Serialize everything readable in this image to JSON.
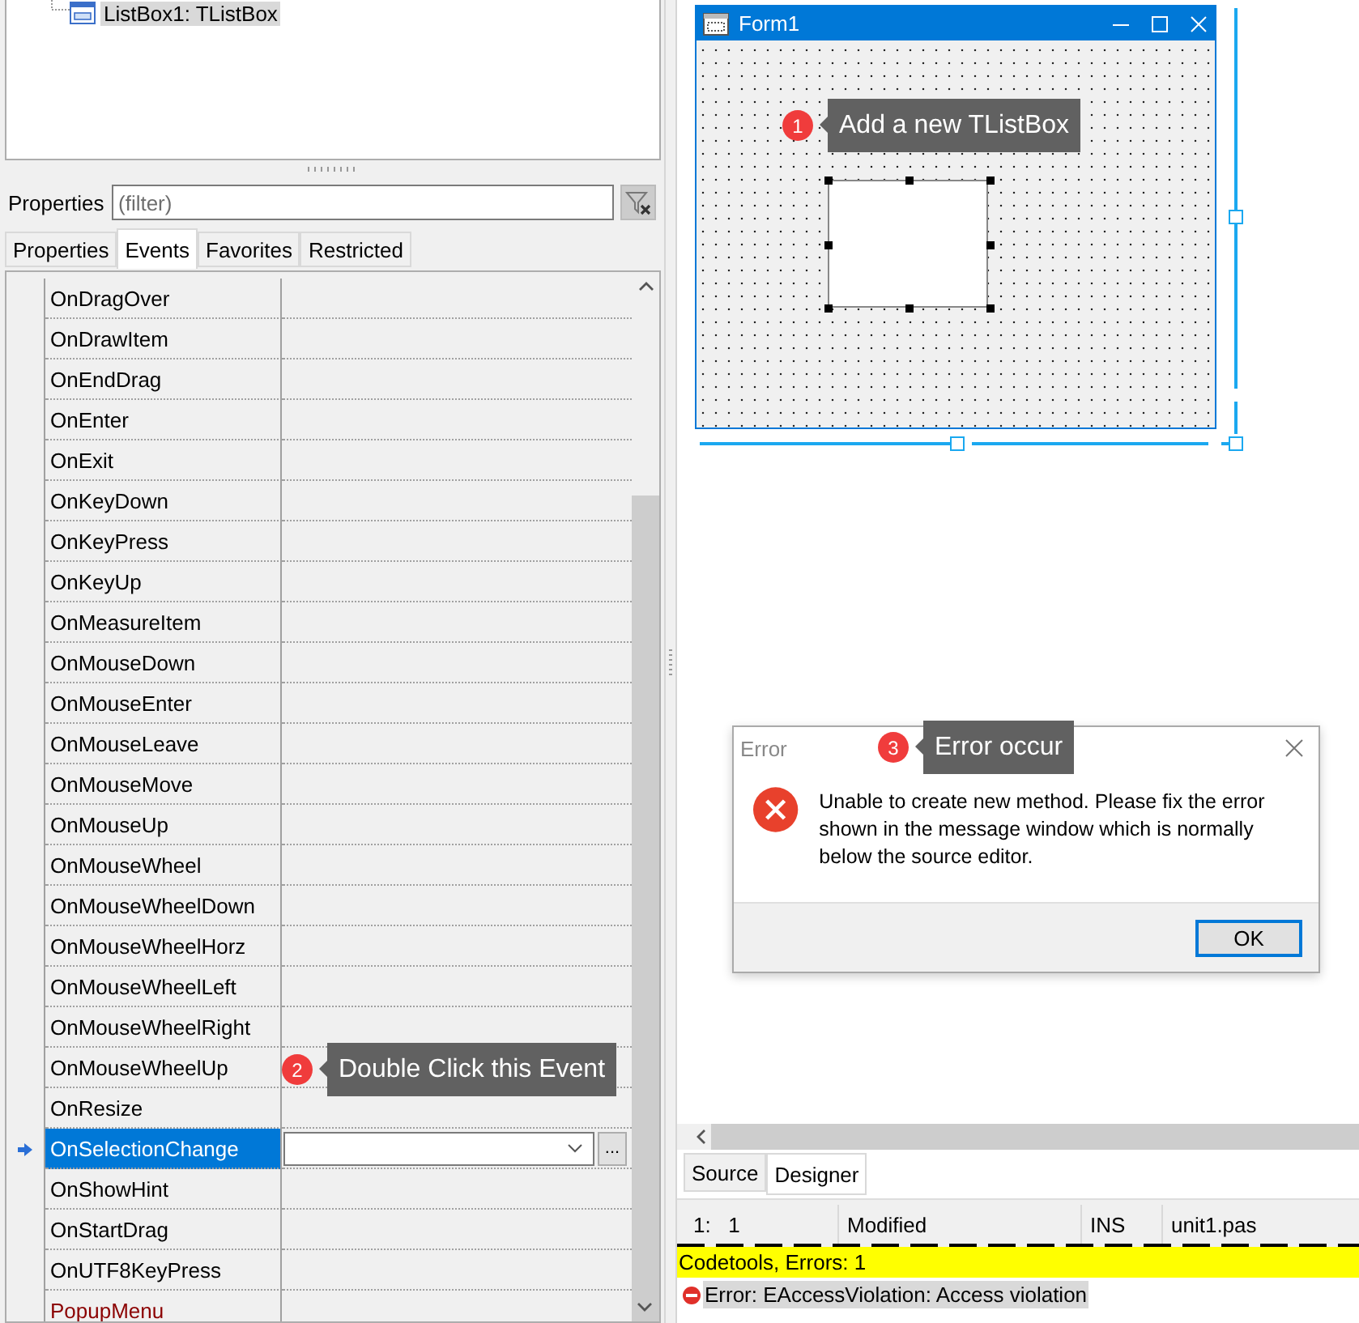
{
  "object_tree": {
    "items": [
      {
        "label": "ListBox1: TListBox",
        "selected": true
      }
    ]
  },
  "object_inspector": {
    "filter_label": "Properties",
    "filter": {
      "placeholder": "(filter)"
    },
    "tabs": [
      {
        "label": "Properties",
        "selected": false
      },
      {
        "label": "Events",
        "selected": true
      },
      {
        "label": "Favorites",
        "selected": false
      },
      {
        "label": "Restricted",
        "selected": false
      }
    ],
    "edit_button": "...",
    "events": [
      {
        "name": "OnDragOver",
        "kind": "event",
        "selected": false
      },
      {
        "name": "OnDrawItem",
        "kind": "event",
        "selected": false
      },
      {
        "name": "OnEndDrag",
        "kind": "event",
        "selected": false
      },
      {
        "name": "OnEnter",
        "kind": "event",
        "selected": false
      },
      {
        "name": "OnExit",
        "kind": "event",
        "selected": false
      },
      {
        "name": "OnKeyDown",
        "kind": "event",
        "selected": false
      },
      {
        "name": "OnKeyPress",
        "kind": "event",
        "selected": false
      },
      {
        "name": "OnKeyUp",
        "kind": "event",
        "selected": false
      },
      {
        "name": "OnMeasureItem",
        "kind": "event",
        "selected": false
      },
      {
        "name": "OnMouseDown",
        "kind": "event",
        "selected": false
      },
      {
        "name": "OnMouseEnter",
        "kind": "event",
        "selected": false
      },
      {
        "name": "OnMouseLeave",
        "kind": "event",
        "selected": false
      },
      {
        "name": "OnMouseMove",
        "kind": "event",
        "selected": false
      },
      {
        "name": "OnMouseUp",
        "kind": "event",
        "selected": false
      },
      {
        "name": "OnMouseWheel",
        "kind": "event",
        "selected": false
      },
      {
        "name": "OnMouseWheelDown",
        "kind": "event",
        "selected": false
      },
      {
        "name": "OnMouseWheelHorz",
        "kind": "event",
        "selected": false
      },
      {
        "name": "OnMouseWheelLeft",
        "kind": "event",
        "selected": false
      },
      {
        "name": "OnMouseWheelRight",
        "kind": "event",
        "selected": false
      },
      {
        "name": "OnMouseWheelUp",
        "kind": "event",
        "selected": false
      },
      {
        "name": "OnResize",
        "kind": "event",
        "selected": false
      },
      {
        "name": "OnSelectionChange",
        "kind": "event",
        "selected": true
      },
      {
        "name": "OnShowHint",
        "kind": "event",
        "selected": false
      },
      {
        "name": "OnStartDrag",
        "kind": "event",
        "selected": false
      },
      {
        "name": "OnUTF8KeyPress",
        "kind": "event",
        "selected": false
      },
      {
        "name": "PopupMenu",
        "kind": "reference",
        "selected": false
      }
    ]
  },
  "designer": {
    "form": {
      "title": "Form1"
    }
  },
  "error_dialog": {
    "title": "Error",
    "message": "Unable to create new method. Please fix the error shown in the message window which is normally below the source editor.",
    "button": "OK"
  },
  "editor_tabs": [
    {
      "label": "Source",
      "selected": false
    },
    {
      "label": "Designer",
      "selected": true
    }
  ],
  "status_bar": [
    "1:   1",
    "Modified",
    "INS",
    "unit1.pas"
  ],
  "messages": {
    "header": "Codetools, Errors: 1",
    "items": [
      {
        "text": "Error: EAccessViolation: Access violation",
        "selected": true
      }
    ]
  },
  "callouts": [
    {
      "number": "1",
      "text": "Add a new TListBox"
    },
    {
      "number": "2",
      "text": "Double Click this Event"
    },
    {
      "number": "3",
      "text": "Error occur"
    }
  ]
}
